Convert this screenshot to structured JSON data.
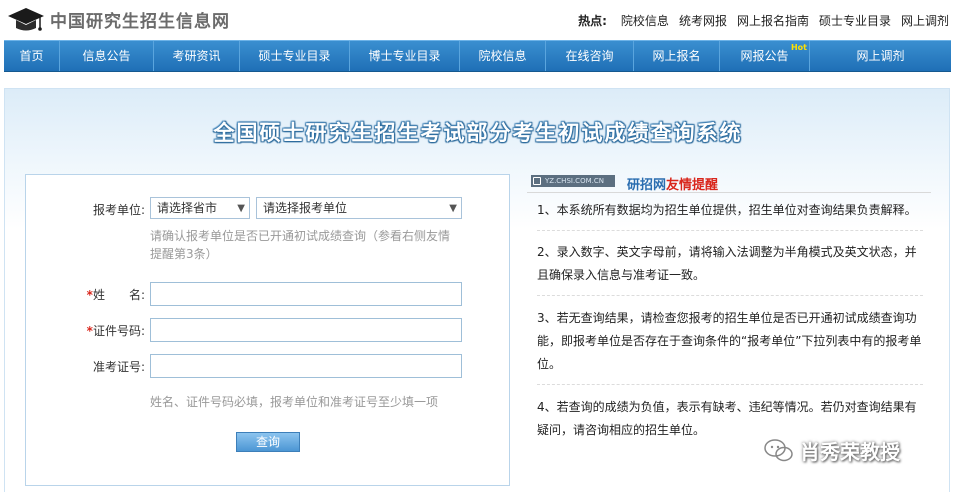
{
  "header": {
    "site_title": "中国研究生招生信息网",
    "hot_label": "热点:",
    "hot_links": [
      "院校信息",
      "统考网报",
      "网上报名指南",
      "硕士专业目录",
      "网上调剂"
    ]
  },
  "nav": {
    "items": [
      "首页",
      "信息公告",
      "考研资讯",
      "硕士专业目录",
      "博士专业目录",
      "院校信息",
      "在线咨询",
      "网上报名",
      "网报公告",
      "网上调剂"
    ],
    "badge": "Hot"
  },
  "main": {
    "system_title": "全国硕士研究生招生考试部分考生初试成绩查询系统",
    "form": {
      "unit_label": "报考单位:",
      "province_select": "请选择省市",
      "unit_select": "请选择报考单位",
      "unit_hint": "请确认报考单位是否已开通初试成绩查询（参看右侧友情提醒第3条）",
      "required_mark": "*",
      "name_label": "姓　　名:",
      "id_label": "证件号码:",
      "ticket_label": "准考证号:",
      "bottom_hint": "姓名、证件号码必填，报考单位和准考证号至少填一项",
      "submit_label": "查询"
    },
    "tips": {
      "tag": "YZ.CHSI.COM.CN",
      "title_brand": "研招网",
      "title_rest": "友情提醒",
      "items": [
        "1、本系统所有数据均为招生单位提供，招生单位对查询结果负责解释。",
        "2、录入数字、英文字母前，请将输入法调整为半角模式及英文状态，并且确保录入信息与准考证一致。",
        "3、若无查询结果，请检查您报考的招生单位是否已开通初试成绩查询功能，即报考单位是否存在于查询条件的“报考单位”下拉列表中有的报考单位。",
        "4、若查询的成绩为负值，表示有缺考、违纪等情况。若仍对查询结果有疑问，请咨询相应的招生单位。"
      ]
    }
  },
  "watermark": {
    "text": "肖秀荣教授"
  }
}
